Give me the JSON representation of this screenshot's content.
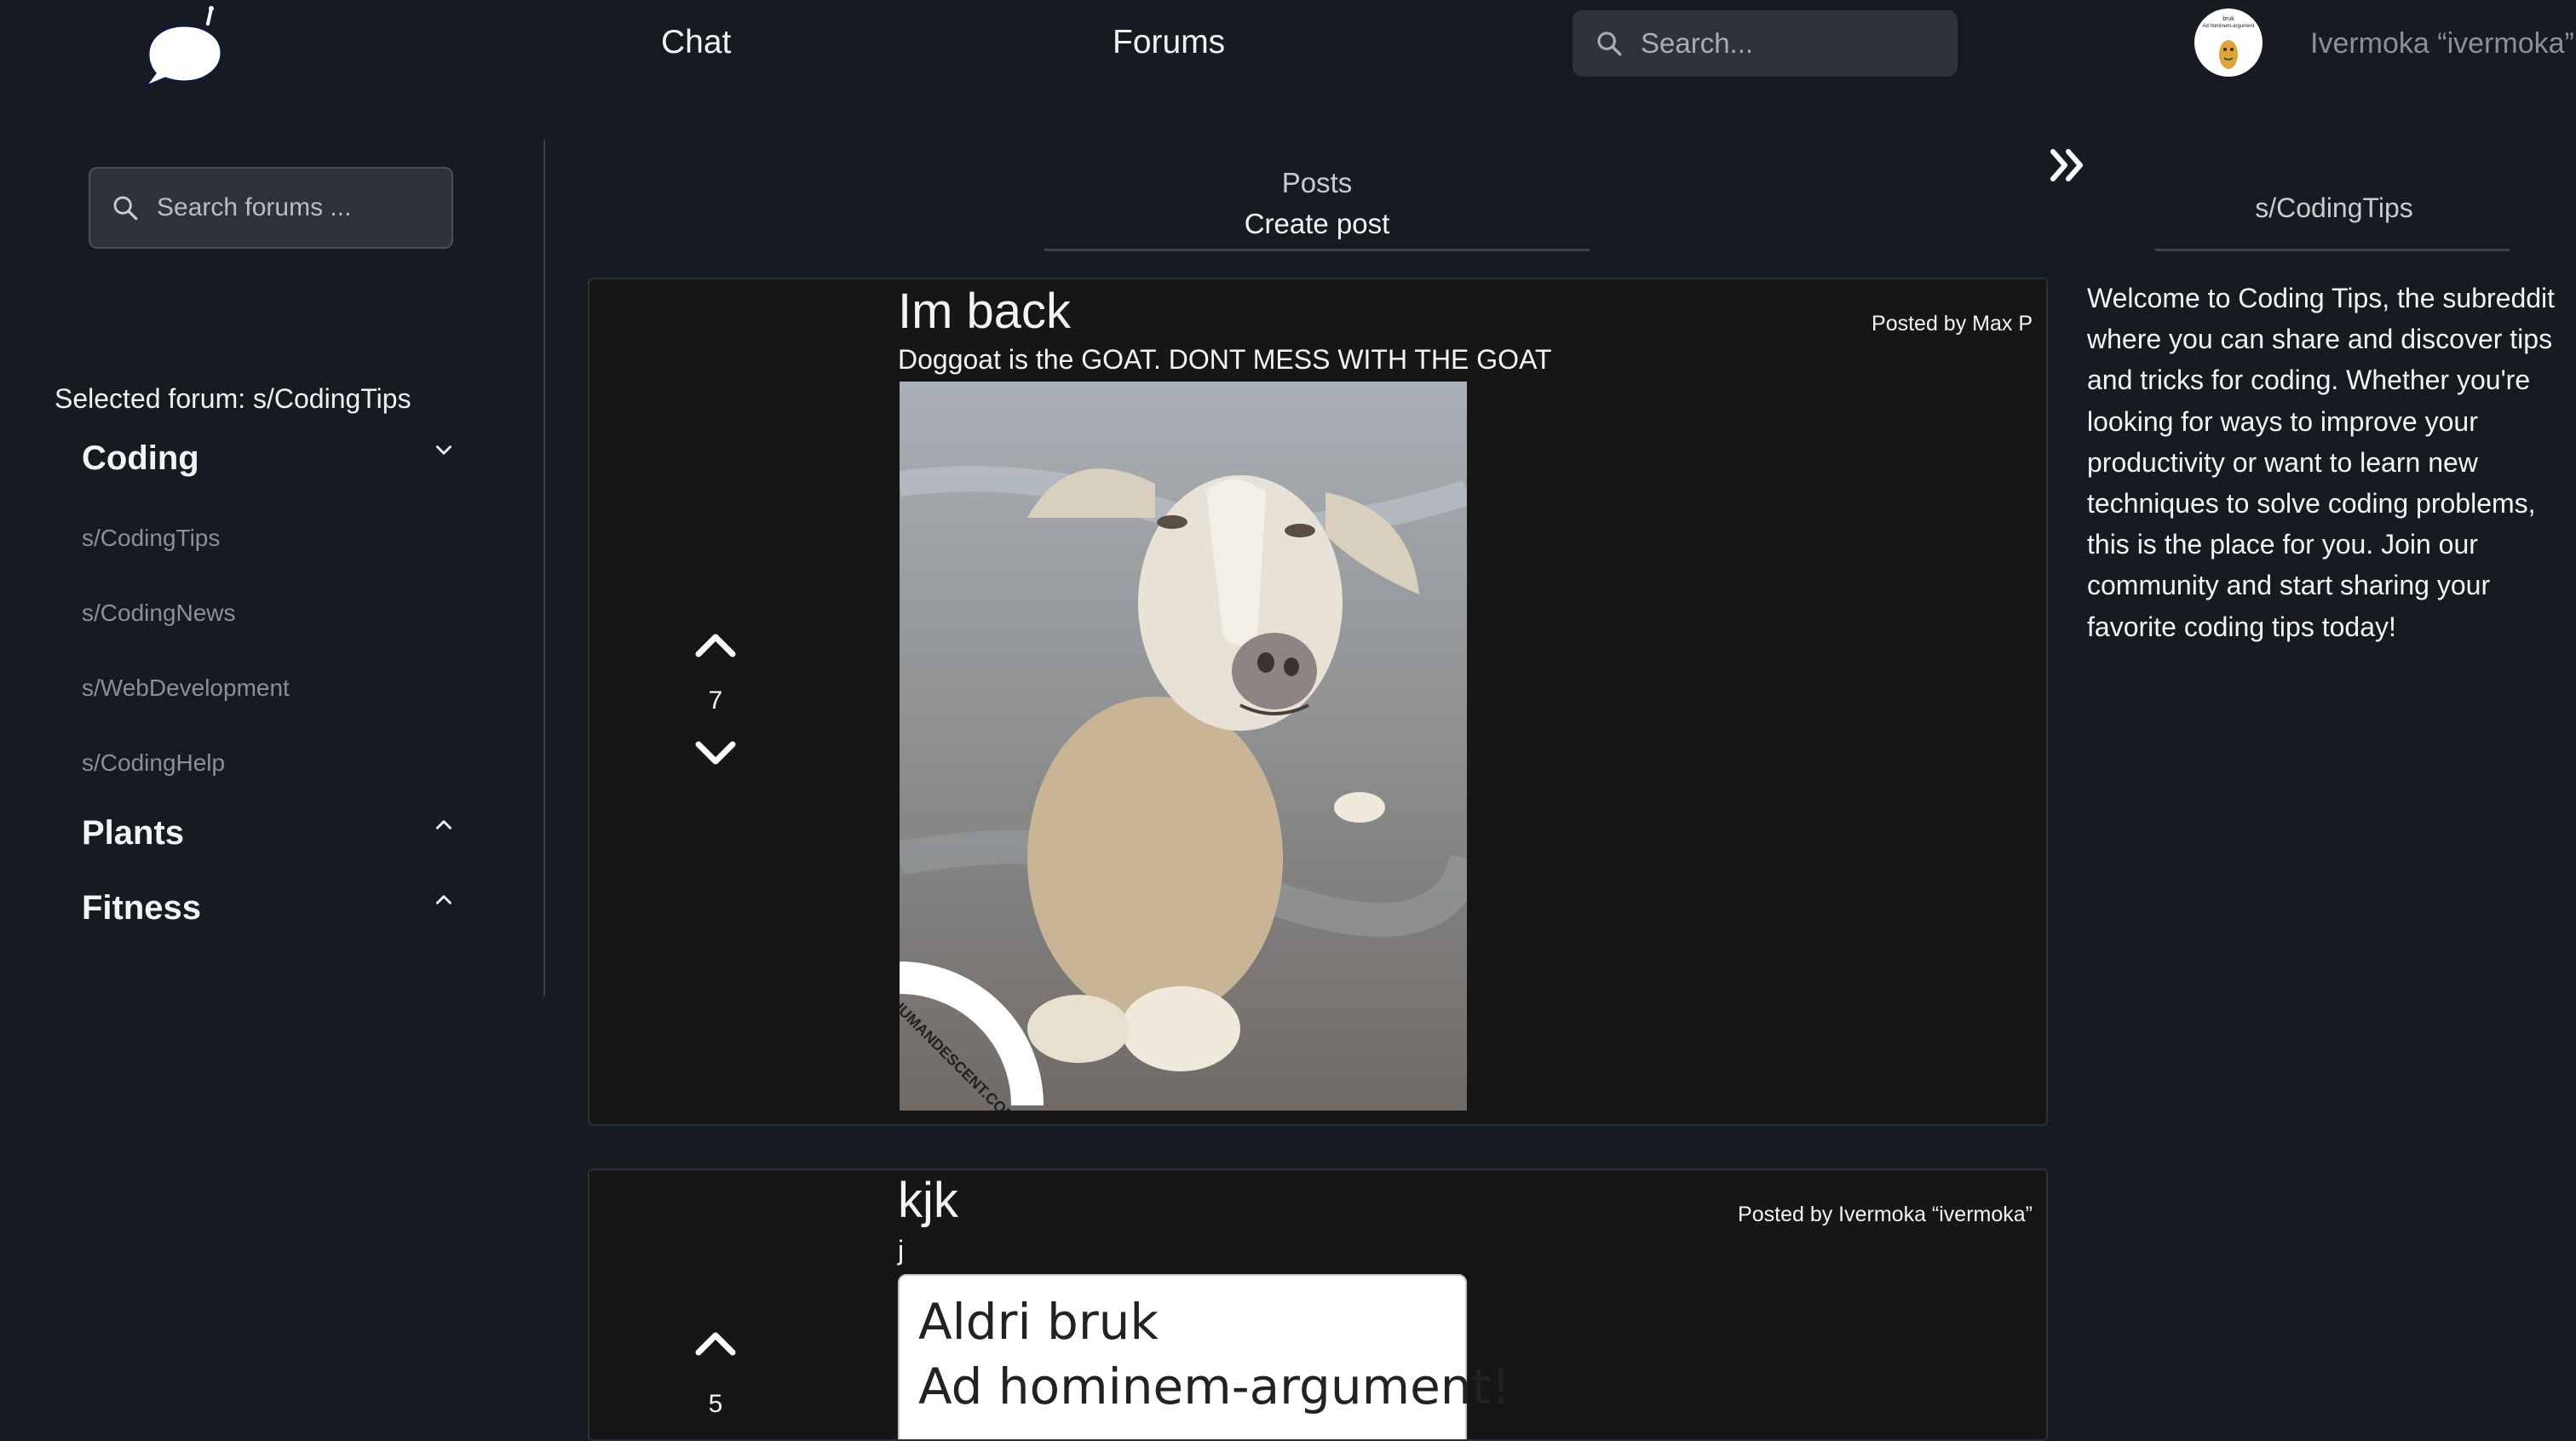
{
  "nav": {
    "chat": "Chat",
    "forums": "Forums",
    "search_placeholder": "Search...",
    "username": "Ivermoka “ivermoka”"
  },
  "avatar": {
    "line1": "bruk",
    "line2": "Ad hominem-argument"
  },
  "sidebar": {
    "search_placeholder": "Search forums ...",
    "selected_forum": "Selected forum: s/CodingTips",
    "categories": [
      {
        "name": "Coding",
        "expanded": true,
        "forums": [
          "s/CodingTips",
          "s/CodingNews",
          "s/WebDevelopment",
          "s/CodingHelp"
        ]
      },
      {
        "name": "Plants",
        "expanded": false
      },
      {
        "name": "Fitness",
        "expanded": false
      }
    ]
  },
  "main": {
    "posts_heading": "Posts",
    "create_post": "Create post",
    "posts": [
      {
        "votes": "7",
        "title": "Im back",
        "body": "Doggoat is the GOAT. DONT MESS WITH THE GOAT",
        "author": "Posted by Max P",
        "image": {
          "watermark": "HUMANDESCENT.COM"
        }
      },
      {
        "votes": "5",
        "title": "kjk",
        "body": "j",
        "author": "Posted by Ivermoka “ivermoka”",
        "image": {
          "line1": "Aldri bruk",
          "line2": "Ad hominem-argument!"
        }
      }
    ]
  },
  "right_panel": {
    "title": "s/CodingTips",
    "description": "Welcome to Coding Tips, the subreddit where you can share and discover tips and tricks for coding. Whether you're looking for ways to improve your productivity or want to learn new techniques to solve coding problems, this is the place for you. Join our community and start sharing your favorite coding tips today!"
  },
  "colors": {
    "background": "#161b22",
    "card": "#161616",
    "input": "#2d323b",
    "muted_text": "#8a9099"
  },
  "icons": [
    "chat-bubble-logo-icon",
    "search-icon",
    "chevron-down-icon",
    "chevron-up-icon",
    "upvote-icon",
    "downvote-icon",
    "double-chevron-right-icon"
  ]
}
